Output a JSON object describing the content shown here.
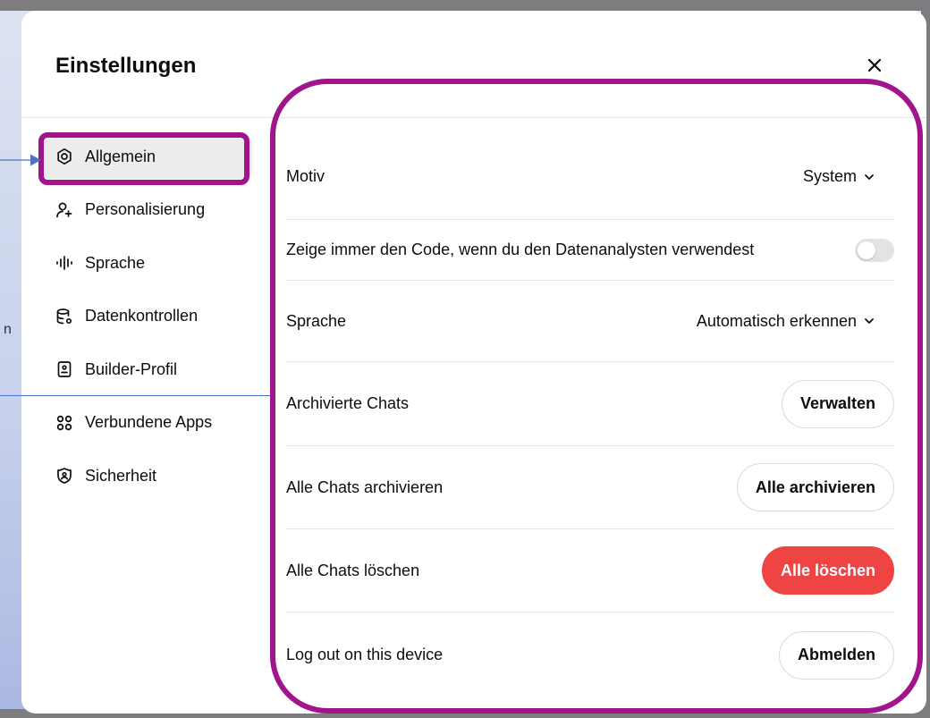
{
  "background": {
    "fragment_text": "n"
  },
  "dialog": {
    "title": "Einstellungen",
    "close_label": "×"
  },
  "sidebar": {
    "items": [
      {
        "label": "Allgemein",
        "icon": "gear-icon",
        "active": true
      },
      {
        "label": "Personalisierung",
        "icon": "person-sparkle-icon",
        "active": false
      },
      {
        "label": "Sprache",
        "icon": "waveform-icon",
        "active": false
      },
      {
        "label": "Datenkontrollen",
        "icon": "database-gear-icon",
        "active": false
      },
      {
        "label": "Builder-Profil",
        "icon": "id-card-icon",
        "active": false
      },
      {
        "label": "Verbundene Apps",
        "icon": "apps-grid-icon",
        "active": false
      },
      {
        "label": "Sicherheit",
        "icon": "shield-lock-icon",
        "active": false
      }
    ]
  },
  "settings": {
    "theme": {
      "label": "Motiv",
      "value": "System"
    },
    "code_toggle": {
      "label": "Zeige immer den Code, wenn du den Datenanalysten verwendest",
      "checked": false
    },
    "language": {
      "label": "Sprache",
      "value": "Automatisch erkennen"
    },
    "archived_chats": {
      "label": "Archivierte Chats",
      "button": "Verwalten"
    },
    "archive_all": {
      "label": "Alle Chats archivieren",
      "button": "Alle archivieren"
    },
    "delete_all": {
      "label": "Alle Chats löschen",
      "button": "Alle löschen"
    },
    "logout": {
      "label": "Log out on this device",
      "button": "Abmelden"
    }
  },
  "colors": {
    "annotation": "#a0148c",
    "annotation_line": "#4f73c7",
    "danger": "#ef4444",
    "active_nav_bg": "#ececec",
    "divider": "#e5e5e5"
  }
}
